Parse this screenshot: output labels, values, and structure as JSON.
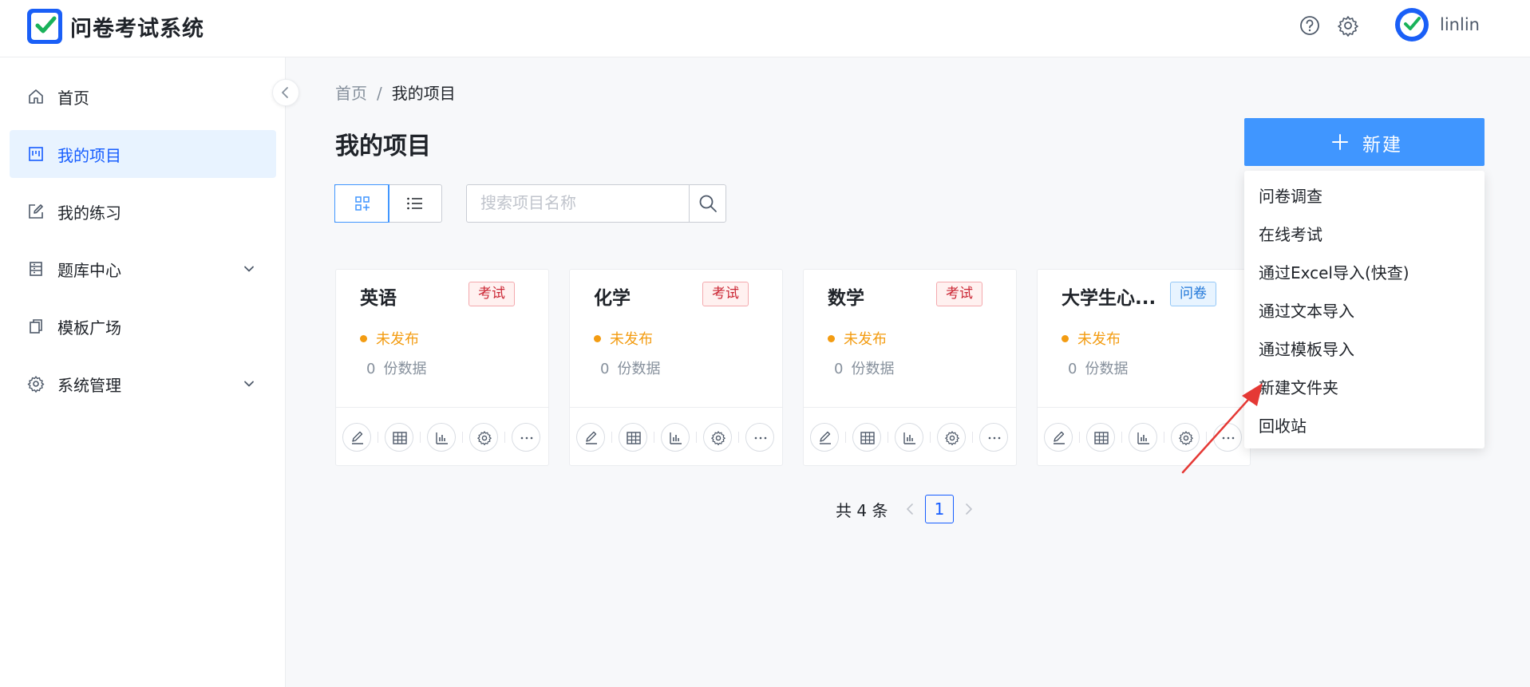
{
  "header": {
    "app_title": "问卷考试系统",
    "username": "linlin",
    "icons": [
      "help-icon",
      "settings-icon"
    ]
  },
  "sidebar": {
    "items": [
      {
        "label": "首页",
        "icon": "home-icon",
        "active": false
      },
      {
        "label": "我的项目",
        "icon": "board-icon",
        "active": true
      },
      {
        "label": "我的练习",
        "icon": "edit-icon",
        "active": false
      },
      {
        "label": "题库中心",
        "icon": "database-icon",
        "active": false,
        "expandable": true
      },
      {
        "label": "模板广场",
        "icon": "copy-icon",
        "active": false
      },
      {
        "label": "系统管理",
        "icon": "gear-icon",
        "active": false,
        "expandable": true
      }
    ]
  },
  "breadcrumb": {
    "root": "首页",
    "separator": "/",
    "current": "我的项目"
  },
  "page_title": "我的项目",
  "new_button": {
    "label": "新建"
  },
  "dropdown": {
    "items": [
      "问卷调查",
      "在线考试",
      "通过Excel导入(快查)",
      "通过文本导入",
      "通过模板导入",
      "新建文件夹",
      "回收站"
    ]
  },
  "search": {
    "placeholder": "搜索项目名称",
    "value": ""
  },
  "cards": [
    {
      "title": "英语",
      "tag": "考试",
      "tag_type": "exam",
      "status": "未发布",
      "count": "0",
      "count_label": "份数据"
    },
    {
      "title": "化学",
      "tag": "考试",
      "tag_type": "exam",
      "status": "未发布",
      "count": "0",
      "count_label": "份数据"
    },
    {
      "title": "数学",
      "tag": "考试",
      "tag_type": "exam",
      "status": "未发布",
      "count": "0",
      "count_label": "份数据"
    },
    {
      "title": "大学生心...",
      "tag": "问卷",
      "tag_type": "survey",
      "status": "未发布",
      "count": "0",
      "count_label": "份数据"
    }
  ],
  "pagination": {
    "total_text": "共 4 条",
    "current_page": "1"
  },
  "colors": {
    "primary": "#165dff",
    "button": "#4096ff",
    "exam_tag": "#cb2634",
    "survey_tag": "#1d75d8",
    "status_unpublished": "#f39c12",
    "annotation_arrow": "#e53935"
  }
}
